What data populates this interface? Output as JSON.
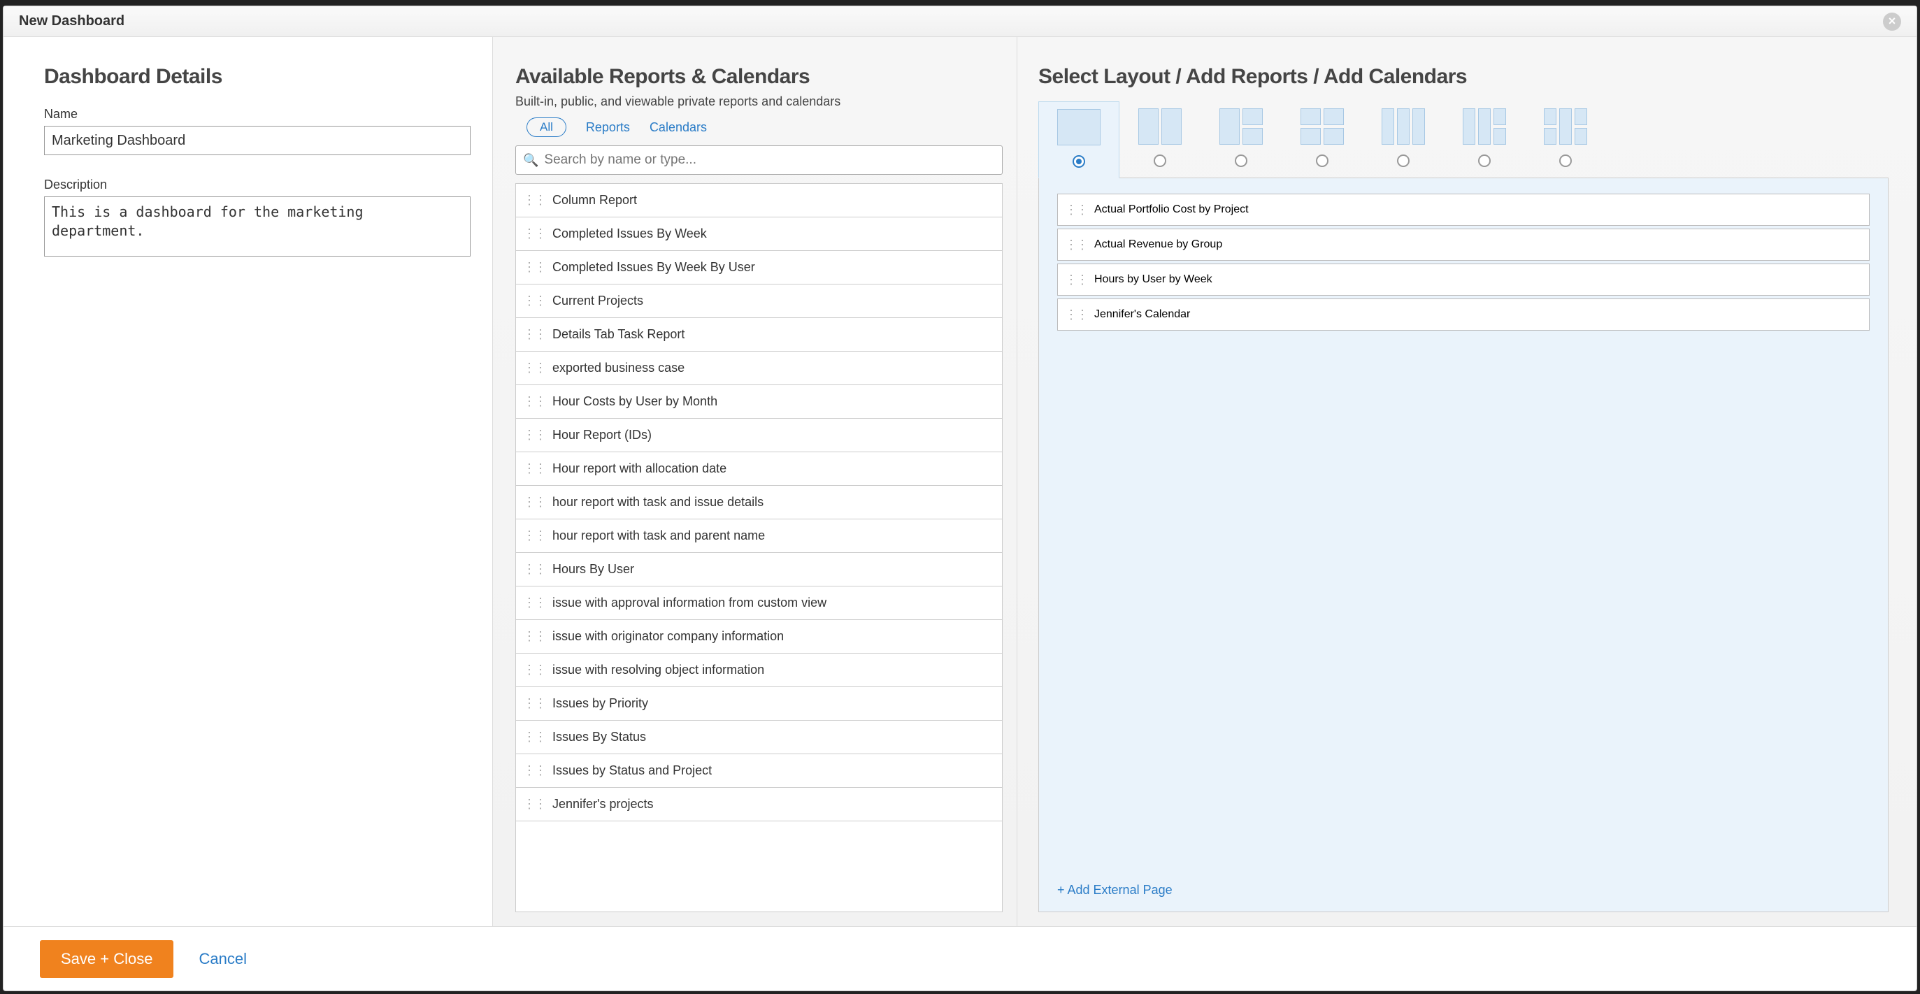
{
  "modal": {
    "title": "New Dashboard",
    "close_label": "×"
  },
  "details": {
    "heading": "Dashboard Details",
    "name_label": "Name",
    "name_value": "Marketing Dashboard",
    "desc_label": "Description",
    "desc_value": "This is a dashboard for the marketing department."
  },
  "available": {
    "heading": "Available Reports & Calendars",
    "subtitle": "Built-in, public, and viewable private reports and calendars",
    "filter_all": "All",
    "filter_reports": "Reports",
    "filter_calendars": "Calendars",
    "search_placeholder": "Search by name or type...",
    "items": [
      "Column Report",
      "Completed Issues By Week",
      "Completed Issues By Week By User",
      "Current Projects",
      "Details Tab Task Report",
      "exported business case",
      "Hour Costs by User by Month",
      "Hour Report (IDs)",
      "Hour report with allocation date",
      "hour report with task and issue details",
      "hour report with task and parent name",
      "Hours By User",
      "issue with approval information from custom view",
      "issue with originator company information",
      "issue with resolving object information",
      "Issues by Priority",
      "Issues By Status",
      "Issues by Status and Project",
      "Jennifer's projects"
    ]
  },
  "layout": {
    "heading": "Select Layout / Add Reports / Add Calendars",
    "selected_index": 0,
    "dropped": [
      "Actual Portfolio Cost by Project",
      "Actual Revenue by Group",
      "Hours by User by Week",
      "Jennifer's Calendar"
    ],
    "add_external": "+ Add External Page"
  },
  "footer": {
    "save": "Save + Close",
    "cancel": "Cancel"
  }
}
